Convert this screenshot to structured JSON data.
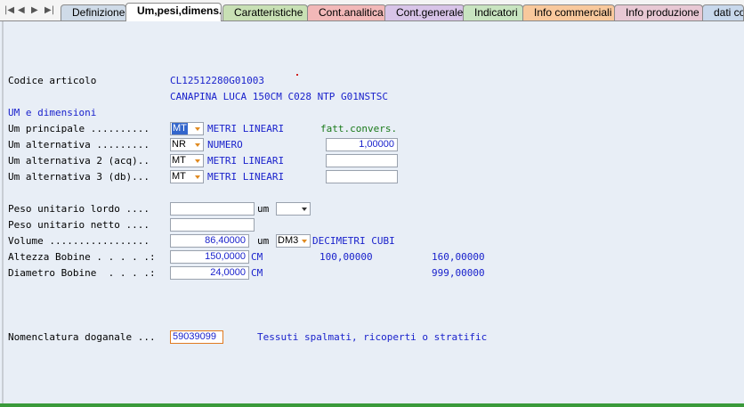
{
  "tabs": [
    {
      "label": "Definizione",
      "color": "#cfdbe8"
    },
    {
      "label": "Um,pesi,dimens.",
      "color": "#ffffff"
    },
    {
      "label": "Caratteristiche",
      "color": "#c8e0b4"
    },
    {
      "label": "Cont.analitica",
      "color": "#f2b8b8"
    },
    {
      "label": "Cont.generale",
      "color": "#d8c4e8"
    },
    {
      "label": "Indicatori",
      "color": "#c8e4c0"
    },
    {
      "label": "Info commerciali",
      "color": "#f8c89c"
    },
    {
      "label": "Info produzione",
      "color": "#e8c8d4"
    },
    {
      "label": "dati co",
      "color": "#c8d8ec"
    }
  ],
  "form": {
    "codice_label": "Codice articolo",
    "codice_value": "CL12512280G01003",
    "descrizione": "CANAPINA LUCA 150CM C028 NTP G01NSTSC",
    "section_um": "UM e dimensioni",
    "um_principale_label": "Um principale ..........",
    "um_principale_code": "MT",
    "um_principale_desc": "METRI LINEARI",
    "fatt_conv_label": "fatt.convers.",
    "um_alternativa_label": "Um alternativa .........",
    "um_alternativa_code": "NR",
    "um_alternativa_desc": "NUMERO",
    "um_alternativa_fatt": "1,00000",
    "um_alt2_label": "Um alternativa 2 (acq)..",
    "um_alt2_code": "MT",
    "um_alt2_desc": "METRI LINEARI",
    "um_alt3_label": "Um alternativa 3 (db)...",
    "um_alt3_code": "MT",
    "um_alt3_desc": "METRI LINEARI",
    "peso_lordo_label": "Peso unitario lordo ....",
    "peso_lordo_value": "",
    "um_label": "um",
    "peso_um_value": "",
    "peso_netto_label": "Peso unitario netto ....",
    "peso_netto_value": "",
    "volume_label": "Volume .................",
    "volume_value": "86,40000",
    "volume_um_code": "DM3",
    "volume_um_desc": "DECIMETRI CUBI",
    "altezza_label": "Altezza Bobine . . . . .:",
    "altezza_value": "150,0000",
    "altezza_um": "CM",
    "altezza_min": "100,00000",
    "altezza_max": "160,00000",
    "diametro_label": "Diametro Bobine  . . . .:",
    "diametro_value": "24,0000",
    "diametro_um": "CM",
    "diametro_max": "999,00000",
    "nomenclatura_label": "Nomenclatura doganale ...",
    "nomenclatura_value": "59039099",
    "nomenclatura_desc": "Tessuti spalmati, ricoperti o stratific"
  }
}
